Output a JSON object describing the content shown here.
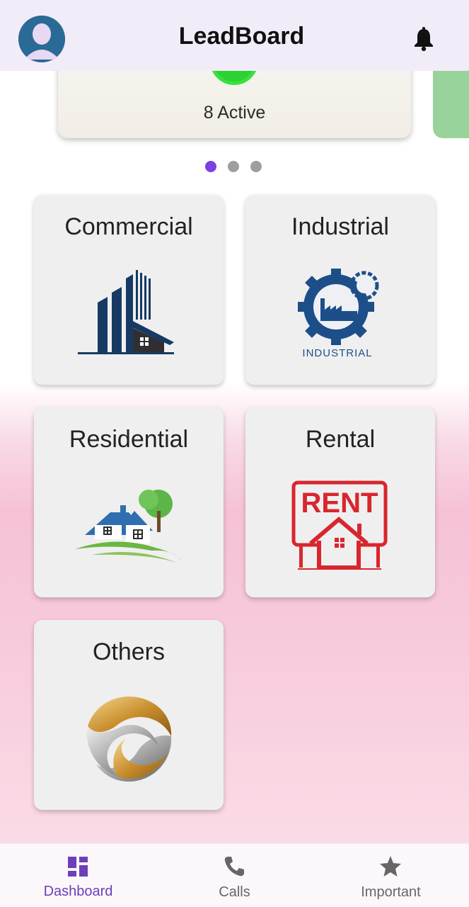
{
  "app": {
    "title": "LeadBoard",
    "icons": {
      "profile": "avatar",
      "notifications": "bell-icon"
    }
  },
  "carousel": {
    "status_text": "8 Active",
    "dot_count": 3,
    "active_dot": 0,
    "accent_color": "#7b3fe4",
    "status_color": "#36e23d"
  },
  "categories": [
    {
      "label": "Commercial",
      "icon": "commercial-building-icon"
    },
    {
      "label": "Industrial",
      "icon": "industrial-gear-icon",
      "icon_text": "INDUSTRIAL"
    },
    {
      "label": "Residential",
      "icon": "residential-house-icon"
    },
    {
      "label": "Rental",
      "icon": "rent-sign-icon",
      "icon_text": "RENT"
    },
    {
      "label": "Others",
      "icon": "others-swirl-icon"
    }
  ],
  "bottom_nav": [
    {
      "label": "Dashboard",
      "icon": "dashboard-icon",
      "selected": true
    },
    {
      "label": "Calls",
      "icon": "phone-icon",
      "selected": false
    },
    {
      "label": "Important",
      "icon": "star-icon",
      "selected": false
    }
  ]
}
